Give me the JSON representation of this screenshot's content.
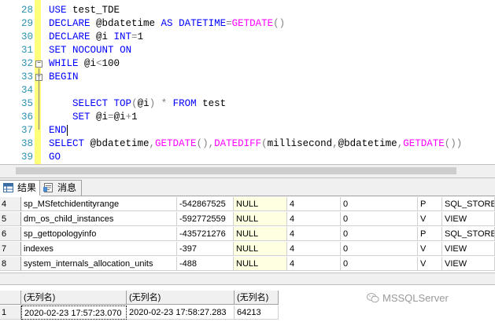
{
  "editor": {
    "lines": [
      {
        "num": "28",
        "code": "USE test_TDE"
      },
      {
        "num": "29",
        "code": "DECLARE @bdatetime AS DATETIME=GETDATE()"
      },
      {
        "num": "30",
        "code": "DECLARE @i INT=1"
      },
      {
        "num": "31",
        "code": "SET NOCOUNT ON"
      },
      {
        "num": "32",
        "code": "WHILE @i<100"
      },
      {
        "num": "33",
        "code": "BEGIN"
      },
      {
        "num": "34",
        "code": ""
      },
      {
        "num": "35",
        "code": "    SELECT TOP(@i) * FROM test"
      },
      {
        "num": "36",
        "code": "    SET @i=@i+1"
      },
      {
        "num": "37",
        "code": "END"
      },
      {
        "num": "38",
        "code": "SELECT @bdatetime,GETDATE(),DATEDIFF(millisecond,@bdatetime,GETDATE())"
      },
      {
        "num": "39",
        "code": "GO"
      }
    ],
    "colors": {
      "keyword": "#0000ff",
      "function": "#ff00ff",
      "operator": "#808080",
      "line_number": "#2b91af"
    }
  },
  "tabs": [
    {
      "label": "结果",
      "icon": "grid-icon"
    },
    {
      "label": "消息",
      "icon": "message-icon"
    }
  ],
  "grid1": {
    "rows": [
      {
        "rownum": "4",
        "name": "sp_MSfetchidentityrange",
        "id": "-542867525",
        "null": "NULL",
        "c4": "4",
        "c5": "0",
        "type": "P",
        "desc": "SQL_STORE"
      },
      {
        "rownum": "5",
        "name": "dm_os_child_instances",
        "id": "-592772559",
        "null": "NULL",
        "c4": "4",
        "c5": "0",
        "type": "V",
        "desc": "VIEW"
      },
      {
        "rownum": "6",
        "name": "sp_gettopologyinfo",
        "id": "-435721276",
        "null": "NULL",
        "c4": "4",
        "c5": "0",
        "type": "P",
        "desc": "SQL_STORE"
      },
      {
        "rownum": "7",
        "name": "indexes",
        "id": "-397",
        "null": "NULL",
        "c4": "4",
        "c5": "0",
        "type": "V",
        "desc": "VIEW"
      },
      {
        "rownum": "8",
        "name": "system_internals_allocation_units",
        "id": "-488",
        "null": "NULL",
        "c4": "4",
        "c5": "0",
        "type": "V",
        "desc": "VIEW"
      }
    ]
  },
  "grid2": {
    "headers": [
      "(无列名)",
      "(无列名)",
      "(无列名)"
    ],
    "rows": [
      {
        "rownum": "1",
        "c1": "2020-02-23 17:57:23.070",
        "c2": "2020-02-23 17:58:27.283",
        "c3": "64213"
      }
    ]
  },
  "watermark": {
    "text": "MSSQLServer",
    "icon": "wechat-icon"
  }
}
